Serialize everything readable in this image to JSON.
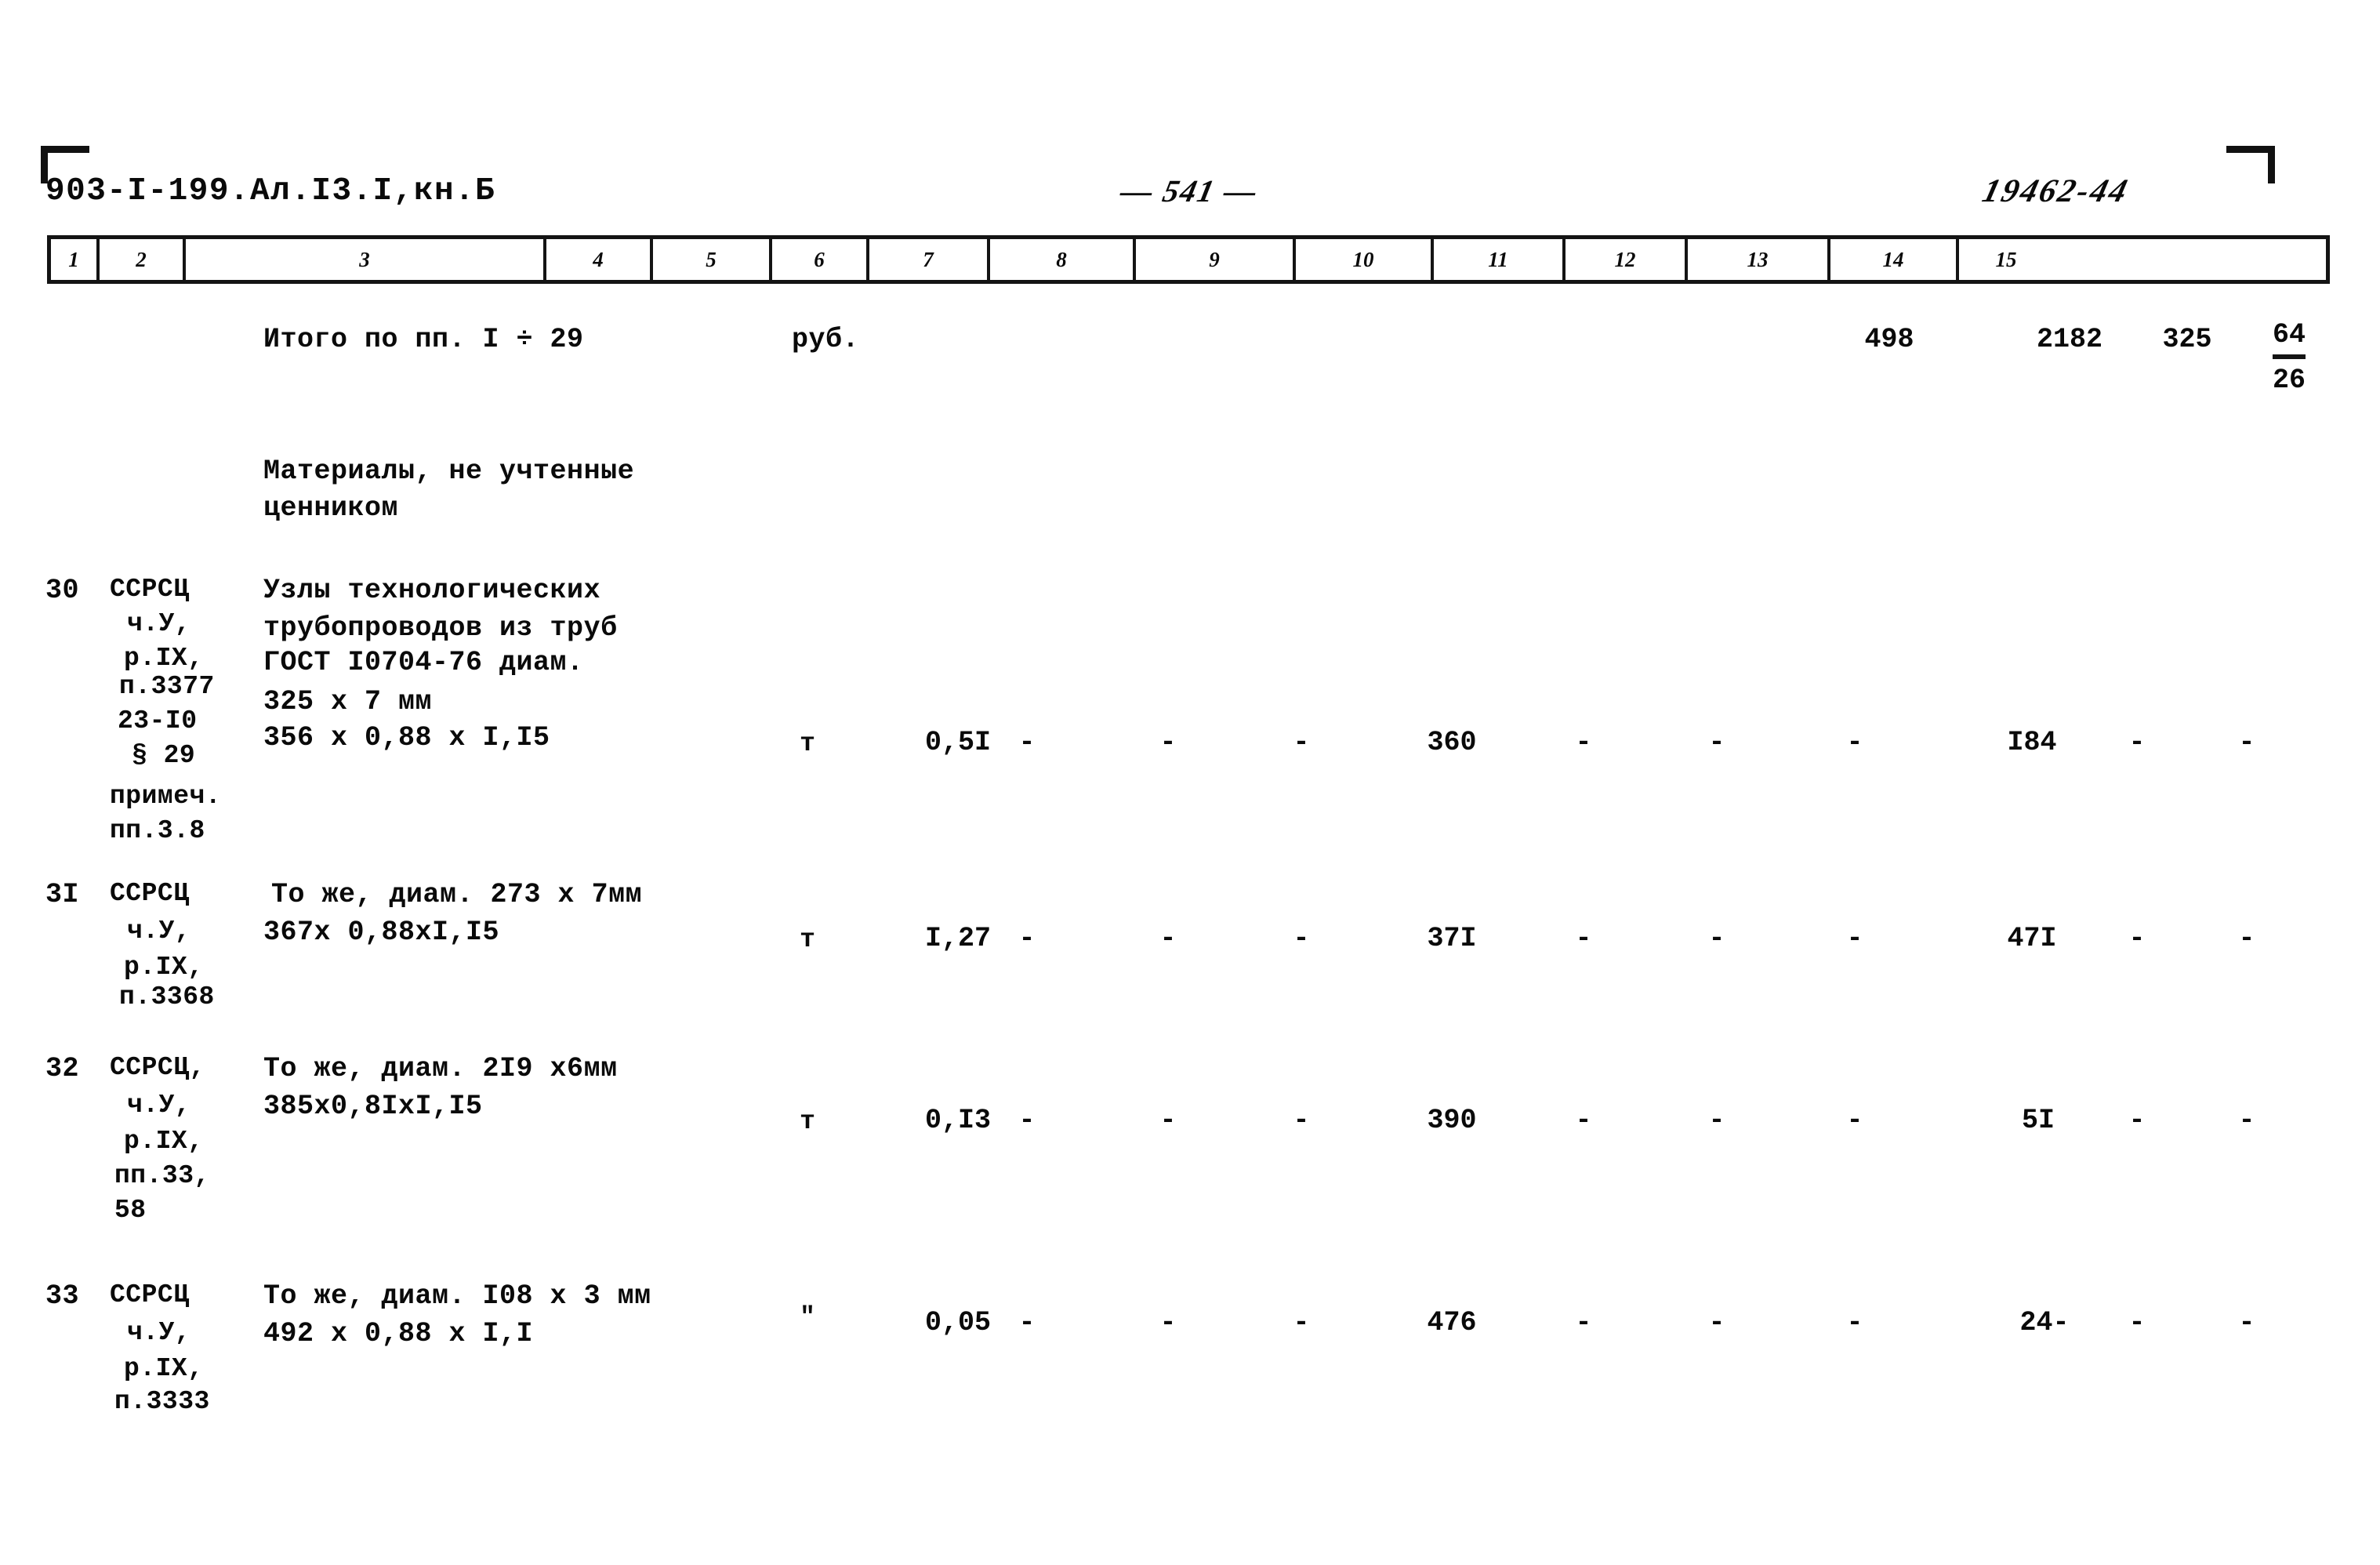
{
  "header": {
    "doc_code": "903-I-199.Ал.I3.I,кн.Б",
    "page_number": "— 541 —",
    "reference_number": "19462-44"
  },
  "column_ruler": {
    "numbers": [
      "1",
      "2",
      "3",
      "4",
      "5",
      "6",
      "7",
      "8",
      "9",
      "10",
      "11",
      "12",
      "13",
      "14",
      "15"
    ]
  },
  "total_row": {
    "label": "Итого по пп. I ÷ 29",
    "unit": "руб.",
    "col12": "498",
    "col13": "2182",
    "col14": "325",
    "col15_numerator": "64",
    "col15_denominator": "26"
  },
  "section_title": {
    "line1": "Материалы, не учтенные",
    "line2": "ценником"
  },
  "rows": [
    {
      "number": "30",
      "code_lines": [
        "ССРСЦ",
        "ч.У,",
        "р.IХ,",
        "п.3377",
        "23-I0",
        "§ 29",
        "примеч.",
        "пп.3.8"
      ],
      "desc_lines": [
        "Узлы технологических",
        "трубопроводов из труб",
        "ГОСТ I0704-76 диам.",
        "325 х 7 мм",
        "356 х 0,88 х I,I5"
      ],
      "unit": "т",
      "col5": "0,5I",
      "col6": "-",
      "col7": "-",
      "col8": "-",
      "col9": "360",
      "col10": "-",
      "col11": "-",
      "col12": "-",
      "col13": "I84",
      "col14": "-",
      "col15": "-"
    },
    {
      "number": "3I",
      "code_lines": [
        "ССРСЦ",
        "ч.У,",
        "р.IХ,",
        "п.3368"
      ],
      "desc_lines": [
        "То же, диам. 273 х 7мм",
        "367х 0,88хI,I5"
      ],
      "unit": "т",
      "col5": "I,27",
      "col6": "-",
      "col7": "-",
      "col8": "-",
      "col9": "37I",
      "col10": "-",
      "col11": "-",
      "col12": "-",
      "col13": "47I",
      "col14": "-",
      "col15": "-"
    },
    {
      "number": "32",
      "code_lines": [
        "ССРСЦ,",
        "ч.У,",
        "р.IХ,",
        "пп.33,",
        "58"
      ],
      "desc_lines": [
        "То же, диам. 2I9 х6мм",
        "385х0,8IхI,I5"
      ],
      "unit": "т",
      "col5": "0,I3",
      "col6": "-",
      "col7": "-",
      "col8": "-",
      "col9": "390",
      "col10": "-",
      "col11": "-",
      "col12": "-",
      "col13": "5I",
      "col14": "-",
      "col15": "-"
    },
    {
      "number": "33",
      "code_lines": [
        "ССРСЦ",
        "ч.У,",
        "р.IХ,",
        "п.3333"
      ],
      "desc_lines": [
        "То же, диам. I08 х 3 мм",
        "492 х 0,88 х I,I"
      ],
      "unit": "\"",
      "col5": "0,05",
      "col6": "-",
      "col7": "-",
      "col8": "-",
      "col9": "476",
      "col10": "-",
      "col11": "-",
      "col12": "-",
      "col13": "24-",
      "col14": "-",
      "col15": "-"
    }
  ]
}
